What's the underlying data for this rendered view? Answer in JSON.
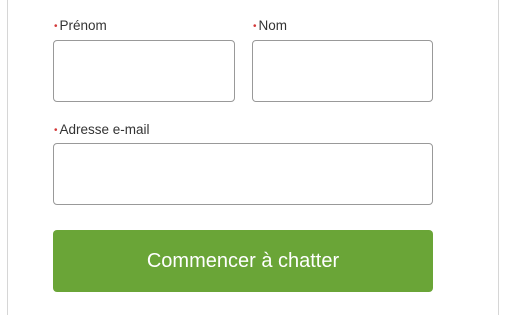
{
  "form": {
    "first_name": {
      "label": "Prénom",
      "required_mark": "•",
      "value": "",
      "placeholder": ""
    },
    "last_name": {
      "label": "Nom",
      "required_mark": "•",
      "value": "",
      "placeholder": ""
    },
    "email": {
      "label": "Adresse e-mail",
      "required_mark": "•",
      "value": "",
      "placeholder": ""
    },
    "submit_label": "Commencer à chatter"
  },
  "colors": {
    "button_bg": "#6aa537",
    "button_text": "#ffffff",
    "required_mark": "#d33a3a",
    "field_border": "#999999"
  }
}
